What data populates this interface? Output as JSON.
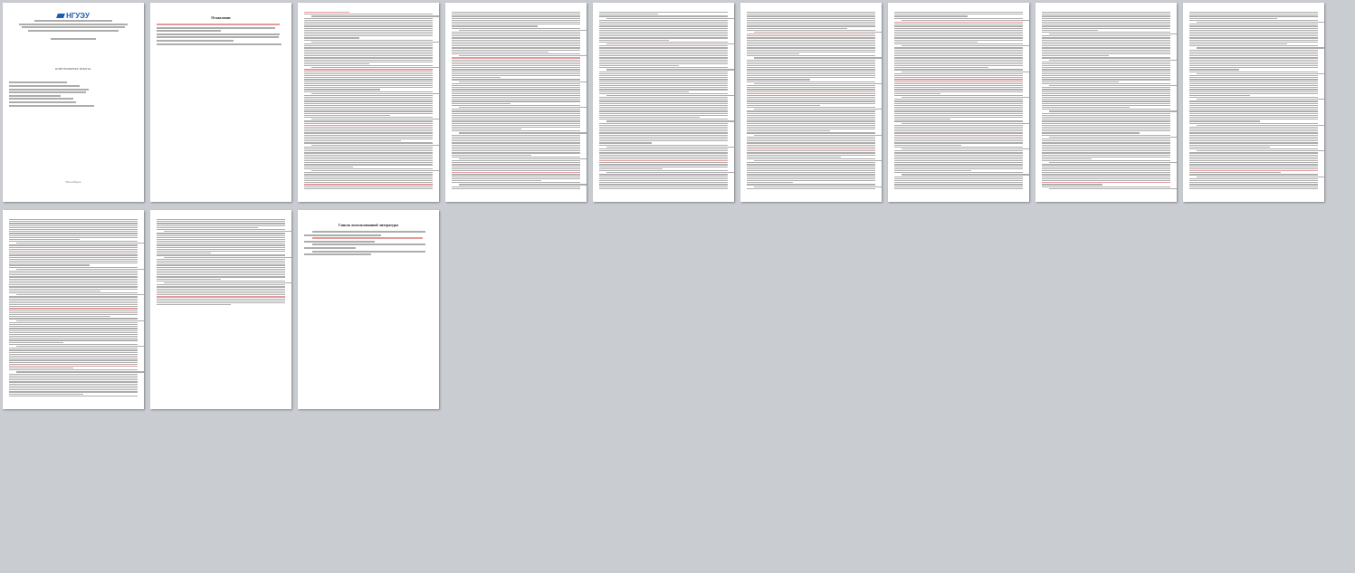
{
  "cover": {
    "logo_text": "НГУЭУ",
    "work_type": "КОНТРОЛЬНАЯ РАБОТА",
    "city": "Новосибирск"
  },
  "toc": {
    "title": "Оглавление",
    "items": [
      "1. Портфель ценных бумаг...",
      "2. Задача...",
      "Список использованной литературы"
    ]
  },
  "bibliography": {
    "title": "Список использованной литературы"
  },
  "colors": {
    "background": "#c9ccd1",
    "page": "#ffffff",
    "text_line": "#6a6a6a",
    "highlight": "#c84848",
    "logo": "#1f5bb5"
  }
}
